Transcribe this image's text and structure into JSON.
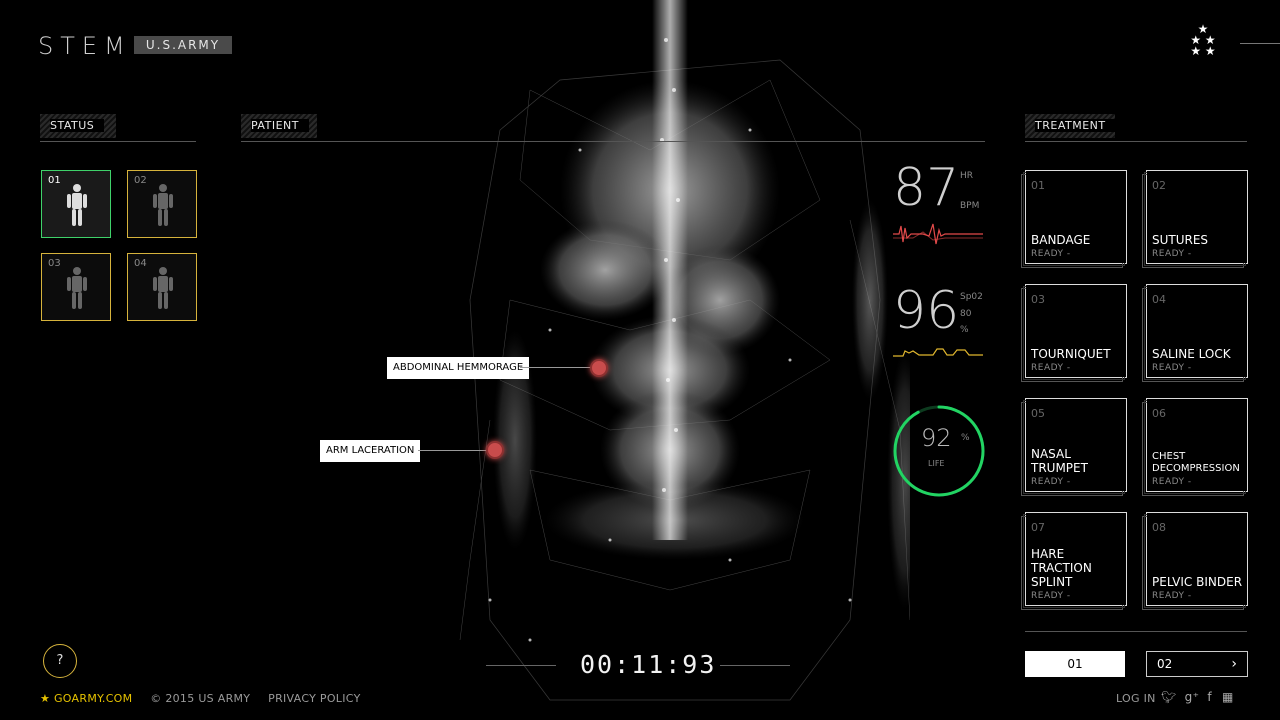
{
  "header": {
    "brand": "STEM",
    "tag": "U.S.ARMY"
  },
  "status": {
    "label": "STATUS",
    "tiles": [
      {
        "num": "01",
        "state": "active"
      },
      {
        "num": "02",
        "state": "inactive"
      },
      {
        "num": "03",
        "state": "inactive"
      },
      {
        "num": "04",
        "state": "inactive"
      }
    ]
  },
  "patient": {
    "label": "PATIENT",
    "injuries": [
      {
        "label": "ABDOMINAL HEMMORAGE"
      },
      {
        "label": "ARM LACERATION"
      }
    ]
  },
  "vitals": {
    "hr": {
      "value": "87",
      "unit_top": "HR",
      "unit_bottom": "BPM",
      "color": "#e24a4a"
    },
    "spo2": {
      "value": "96",
      "unit_top": "Sp02",
      "unit_mid": "80",
      "unit_bottom": "%",
      "color": "#e0b62e"
    },
    "life": {
      "value": "92",
      "unit": "%",
      "label": "LIFE",
      "fraction": 0.92,
      "color": "#22d463"
    }
  },
  "treatment": {
    "label": "TREATMENT",
    "items": [
      {
        "num": "01",
        "name": "BANDAGE",
        "status": "READY -"
      },
      {
        "num": "02",
        "name": "SUTURES",
        "status": "READY -"
      },
      {
        "num": "03",
        "name": "TOURNIQUET",
        "status": "READY -"
      },
      {
        "num": "04",
        "name": "SALINE LOCK",
        "status": "READY -"
      },
      {
        "num": "05",
        "name": "NASAL TRUMPET",
        "status": "READY -"
      },
      {
        "num": "06",
        "name": "CHEST DECOMPRESSION",
        "status": "READY -"
      },
      {
        "num": "07",
        "name": "HARE TRACTION SPLINT",
        "status": "READY -"
      },
      {
        "num": "08",
        "name": "PELVIC BINDER",
        "status": "READY -"
      }
    ],
    "pages": [
      {
        "label": "01",
        "active": true
      },
      {
        "label": "02",
        "active": false
      }
    ]
  },
  "timer": "00:11:93",
  "help": "?",
  "footer": {
    "goarmy": "GOARMY.COM",
    "copyright": "© 2015 US ARMY",
    "privacy": "PRIVACY POLICY",
    "login": "LOG IN",
    "icons": [
      "twitter-icon",
      "google-plus-icon",
      "facebook-icon",
      "menu-grid-icon"
    ]
  },
  "colors": {
    "accent_yellow": "#d6b33c",
    "active_green": "#3fd26a",
    "injury_red": "#c94c4c"
  }
}
